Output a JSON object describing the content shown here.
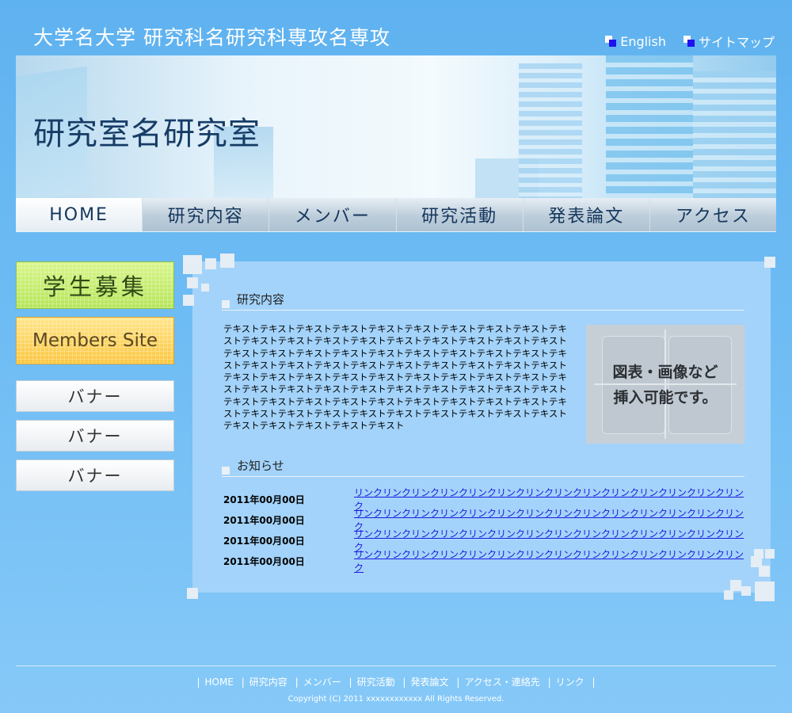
{
  "header": {
    "site_title": "大学名大学 研究科名研究科専攻名専攻",
    "util_links": [
      {
        "label": "English"
      },
      {
        "label": "サイトマップ"
      }
    ],
    "lab_name": "研究室名研究室"
  },
  "nav": {
    "items": [
      {
        "label": "HOME"
      },
      {
        "label": "研究内容"
      },
      {
        "label": "メンバー"
      },
      {
        "label": "研究活動"
      },
      {
        "label": "発表論文"
      },
      {
        "label": "アクセス"
      }
    ]
  },
  "sidebar": {
    "recruit": "学生募集",
    "members_site": "Members Site",
    "banners": [
      "バナー",
      "バナー",
      "バナー"
    ]
  },
  "main": {
    "research": {
      "heading": "研究内容",
      "body": "テキストテキストテキストテキストテキストテキストテキストテキストテキストテキストテキストテキストテキストテキストテキストテキストテキストテキストテキストテキストテキストテキストテキストテキストテキストテキストテキストテキストテキストテキストテキストテキストテキストテキストテキストテキストテキストテキストテキストテキストテキストテキストテキストテキストテキストテキストテキストテキストテキストテキストテキストテキストテキストテキストテキストテキストテキストテキストテキストテキストテキストテキストテキストテキストテキストテキストテキストテキストテキストテキストテキストテキストテキストテキストテキストテキストテキストテキストテキストテキストテキスト",
      "figure_text": "図表・画像など\n挿入可能です。"
    },
    "news": {
      "heading": "お知らせ",
      "items": [
        {
          "date": "2011年00月00日",
          "link": "リンクリンクリンクリンクリンクリンクリンクリンクリンクリンクリンクリンクリンクリンク"
        },
        {
          "date": "2011年00月00日",
          "link": "リンクリンクリンクリンクリンクリンクリンクリンクリンクリンクリンクリンクリンクリンク"
        },
        {
          "date": "2011年00月00日",
          "link": "リンクリンクリンクリンクリンクリンクリンクリンクリンクリンクリンクリンクリンクリンク"
        },
        {
          "date": "2011年00月00日",
          "link": "リンクリンクリンクリンクリンクリンクリンクリンクリンクリンクリンクリンクリンクリンク"
        }
      ]
    }
  },
  "footer": {
    "nav": [
      "HOME",
      "研究内容",
      "メンバー",
      "研究活動",
      "発表論文",
      "アクセス・連絡先",
      "リンク"
    ],
    "copyright": "Copyright (C) 2011 xxxxxxxxxxxx All Rights Reserved."
  }
}
